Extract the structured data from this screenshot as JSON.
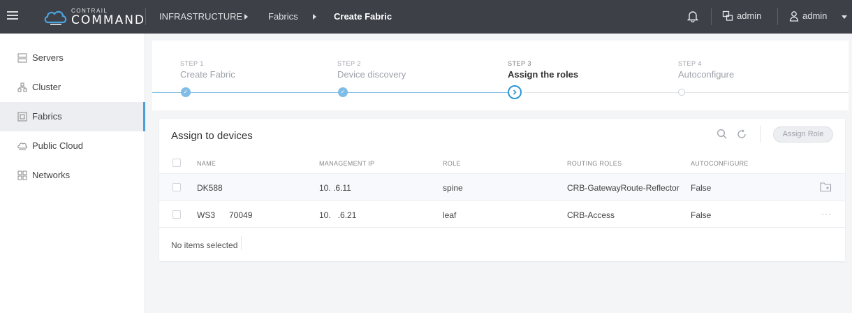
{
  "header": {
    "logo_small": "CONTRAIL",
    "logo_big": "COMMAND",
    "breadcrumb": [
      "INFRASTRUCTURE",
      "Fabrics",
      "Create Fabric"
    ],
    "tenant_label": "admin",
    "user_label": "admin"
  },
  "sidebar": {
    "items": [
      {
        "label": "Servers",
        "icon": "servers-icon"
      },
      {
        "label": "Cluster",
        "icon": "cluster-icon"
      },
      {
        "label": "Fabrics",
        "icon": "fabrics-icon",
        "selected": true
      },
      {
        "label": "Public Cloud",
        "icon": "cloud-icon"
      },
      {
        "label": "Networks",
        "icon": "networks-icon"
      }
    ]
  },
  "wizard": {
    "steps": [
      {
        "num": "STEP 1",
        "name": "Create Fabric",
        "state": "done"
      },
      {
        "num": "STEP 2",
        "name": "Device discovery",
        "state": "done"
      },
      {
        "num": "STEP 3",
        "name": "Assign the roles",
        "state": "current"
      },
      {
        "num": "STEP 4",
        "name": "Autoconfigure",
        "state": "pending"
      }
    ],
    "done_mark": "✓"
  },
  "devices": {
    "title": "Assign to devices",
    "assign_button": "Assign Role",
    "columns": [
      "NAME",
      "MANAGEMENT IP",
      "ROLE",
      "ROUTING ROLES",
      "AUTOCONFIGURE"
    ],
    "rows": [
      {
        "name": "DK588",
        "ip": "10.   .6.11",
        "role": "spine",
        "routing": "CRB-GatewayRoute-Reflector",
        "auto": "False"
      },
      {
        "name": "WS3      70049",
        "ip": "10.   .6.21",
        "role": "leaf",
        "routing": "CRB-Access",
        "auto": "False"
      }
    ],
    "more_label": "···",
    "footer": "No items selected"
  },
  "colors": {
    "topbar": "#3d4047",
    "accent": "#2f94d6",
    "accent_light": "#7fbde6"
  }
}
